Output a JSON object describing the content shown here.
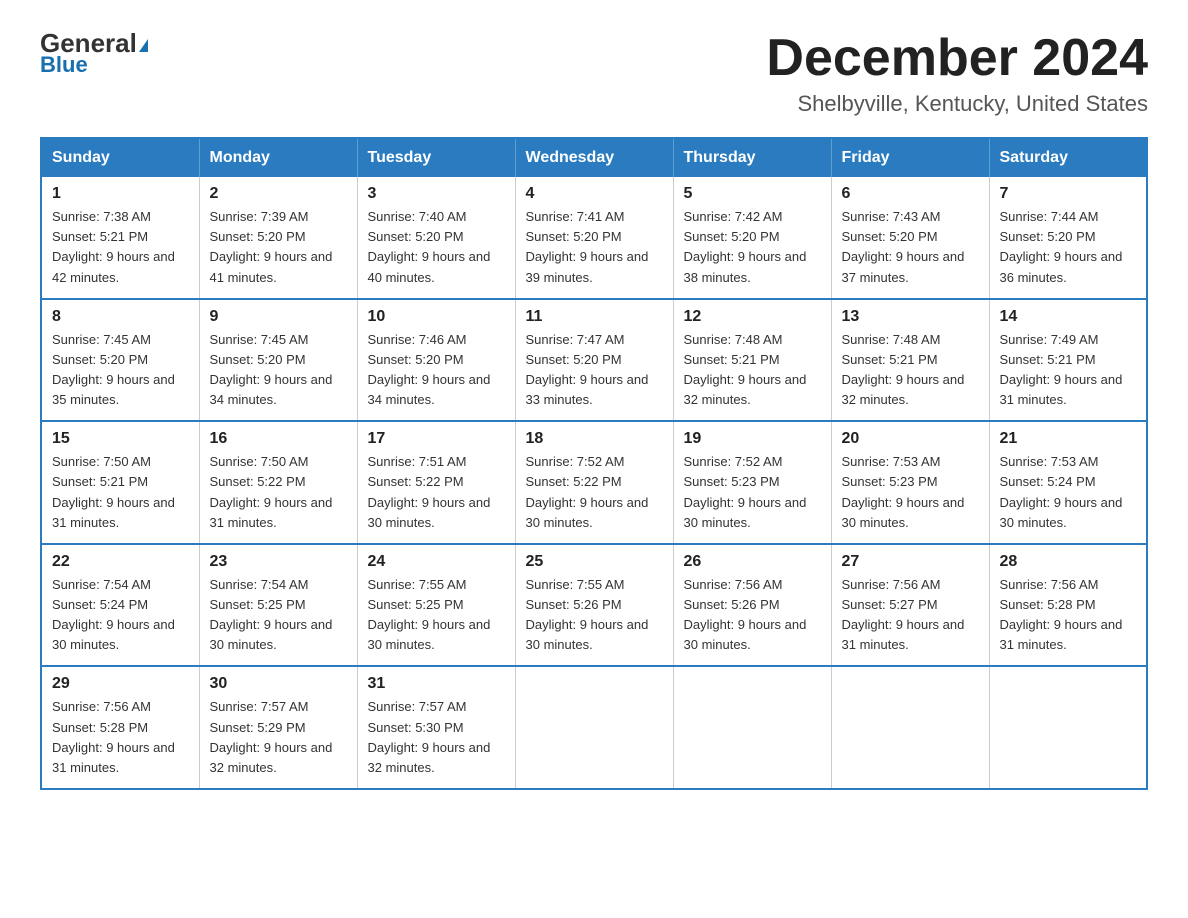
{
  "logo": {
    "general": "General",
    "blue": "Blue"
  },
  "header": {
    "title": "December 2024",
    "subtitle": "Shelbyville, Kentucky, United States"
  },
  "weekdays": [
    "Sunday",
    "Monday",
    "Tuesday",
    "Wednesday",
    "Thursday",
    "Friday",
    "Saturday"
  ],
  "weeks": [
    [
      {
        "day": "1",
        "sunrise": "7:38 AM",
        "sunset": "5:21 PM",
        "daylight": "9 hours and 42 minutes."
      },
      {
        "day": "2",
        "sunrise": "7:39 AM",
        "sunset": "5:20 PM",
        "daylight": "9 hours and 41 minutes."
      },
      {
        "day": "3",
        "sunrise": "7:40 AM",
        "sunset": "5:20 PM",
        "daylight": "9 hours and 40 minutes."
      },
      {
        "day": "4",
        "sunrise": "7:41 AM",
        "sunset": "5:20 PM",
        "daylight": "9 hours and 39 minutes."
      },
      {
        "day": "5",
        "sunrise": "7:42 AM",
        "sunset": "5:20 PM",
        "daylight": "9 hours and 38 minutes."
      },
      {
        "day": "6",
        "sunrise": "7:43 AM",
        "sunset": "5:20 PM",
        "daylight": "9 hours and 37 minutes."
      },
      {
        "day": "7",
        "sunrise": "7:44 AM",
        "sunset": "5:20 PM",
        "daylight": "9 hours and 36 minutes."
      }
    ],
    [
      {
        "day": "8",
        "sunrise": "7:45 AM",
        "sunset": "5:20 PM",
        "daylight": "9 hours and 35 minutes."
      },
      {
        "day": "9",
        "sunrise": "7:45 AM",
        "sunset": "5:20 PM",
        "daylight": "9 hours and 34 minutes."
      },
      {
        "day": "10",
        "sunrise": "7:46 AM",
        "sunset": "5:20 PM",
        "daylight": "9 hours and 34 minutes."
      },
      {
        "day": "11",
        "sunrise": "7:47 AM",
        "sunset": "5:20 PM",
        "daylight": "9 hours and 33 minutes."
      },
      {
        "day": "12",
        "sunrise": "7:48 AM",
        "sunset": "5:21 PM",
        "daylight": "9 hours and 32 minutes."
      },
      {
        "day": "13",
        "sunrise": "7:48 AM",
        "sunset": "5:21 PM",
        "daylight": "9 hours and 32 minutes."
      },
      {
        "day": "14",
        "sunrise": "7:49 AM",
        "sunset": "5:21 PM",
        "daylight": "9 hours and 31 minutes."
      }
    ],
    [
      {
        "day": "15",
        "sunrise": "7:50 AM",
        "sunset": "5:21 PM",
        "daylight": "9 hours and 31 minutes."
      },
      {
        "day": "16",
        "sunrise": "7:50 AM",
        "sunset": "5:22 PM",
        "daylight": "9 hours and 31 minutes."
      },
      {
        "day": "17",
        "sunrise": "7:51 AM",
        "sunset": "5:22 PM",
        "daylight": "9 hours and 30 minutes."
      },
      {
        "day": "18",
        "sunrise": "7:52 AM",
        "sunset": "5:22 PM",
        "daylight": "9 hours and 30 minutes."
      },
      {
        "day": "19",
        "sunrise": "7:52 AM",
        "sunset": "5:23 PM",
        "daylight": "9 hours and 30 minutes."
      },
      {
        "day": "20",
        "sunrise": "7:53 AM",
        "sunset": "5:23 PM",
        "daylight": "9 hours and 30 minutes."
      },
      {
        "day": "21",
        "sunrise": "7:53 AM",
        "sunset": "5:24 PM",
        "daylight": "9 hours and 30 minutes."
      }
    ],
    [
      {
        "day": "22",
        "sunrise": "7:54 AM",
        "sunset": "5:24 PM",
        "daylight": "9 hours and 30 minutes."
      },
      {
        "day": "23",
        "sunrise": "7:54 AM",
        "sunset": "5:25 PM",
        "daylight": "9 hours and 30 minutes."
      },
      {
        "day": "24",
        "sunrise": "7:55 AM",
        "sunset": "5:25 PM",
        "daylight": "9 hours and 30 minutes."
      },
      {
        "day": "25",
        "sunrise": "7:55 AM",
        "sunset": "5:26 PM",
        "daylight": "9 hours and 30 minutes."
      },
      {
        "day": "26",
        "sunrise": "7:56 AM",
        "sunset": "5:26 PM",
        "daylight": "9 hours and 30 minutes."
      },
      {
        "day": "27",
        "sunrise": "7:56 AM",
        "sunset": "5:27 PM",
        "daylight": "9 hours and 31 minutes."
      },
      {
        "day": "28",
        "sunrise": "7:56 AM",
        "sunset": "5:28 PM",
        "daylight": "9 hours and 31 minutes."
      }
    ],
    [
      {
        "day": "29",
        "sunrise": "7:56 AM",
        "sunset": "5:28 PM",
        "daylight": "9 hours and 31 minutes."
      },
      {
        "day": "30",
        "sunrise": "7:57 AM",
        "sunset": "5:29 PM",
        "daylight": "9 hours and 32 minutes."
      },
      {
        "day": "31",
        "sunrise": "7:57 AM",
        "sunset": "5:30 PM",
        "daylight": "9 hours and 32 minutes."
      },
      null,
      null,
      null,
      null
    ]
  ]
}
